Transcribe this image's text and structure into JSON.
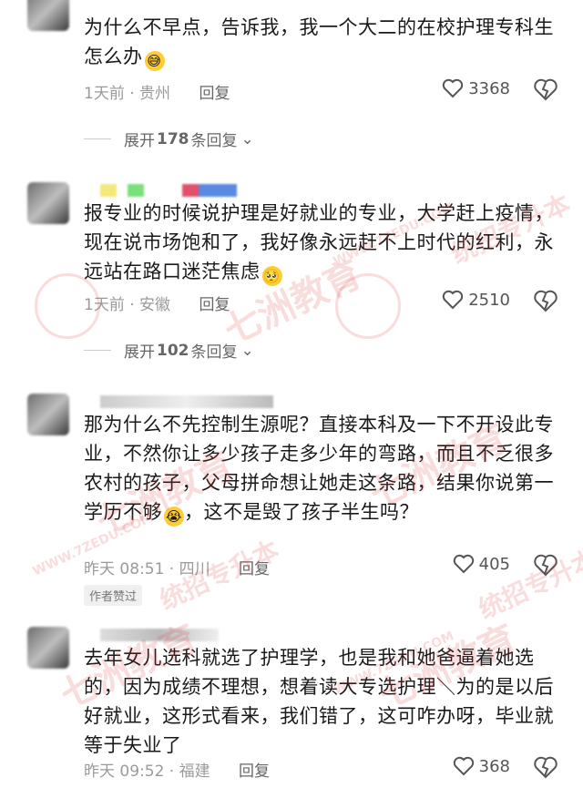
{
  "comments": [
    {
      "text": "为什么不早点，告诉我，我一个大二的在校护理专科生怎么办",
      "emoji": "😅",
      "time": "1天前",
      "location": "贵州",
      "reply": "回复",
      "likes": "3368",
      "expand": {
        "prefix": "展开",
        "count": "178",
        "suffix": "条回复"
      }
    },
    {
      "text": "报专业的时候说护理是好就业的专业，大学赶上疫情，现在说市场饱和了，我好像永远赶不上时代的红利，永远站在路口迷茫焦虑",
      "emoji": "🥺",
      "time": "1天前",
      "location": "安徽",
      "reply": "回复",
      "likes": "2510",
      "expand": {
        "prefix": "展开",
        "count": "102",
        "suffix": "条回复"
      }
    },
    {
      "text": "那为什么不先控制生源呢？直接本科及一下不开设此专业，不然你让多少孩子走多少年的弯路，而且不乏很多农村的孩子，父母拼命想让她走这条路，结果你说第一学历不够",
      "emoji": "😭",
      "text_after": "，这不是毁了孩子半生吗？",
      "time": "昨天 08:51",
      "location": "四川",
      "reply": "回复",
      "likes": "405",
      "author_liked": "作者赞过"
    },
    {
      "text": "去年女儿选科就选了护理学，也是我和她爸逼着她选的，因为成绩不理想，想着读大专选护理＼为的是以后好就业，这形式看来，我们错了，这可咋办呀，毕业就等于失业了",
      "time": "昨天 09:52",
      "location": "福建",
      "reply": "回复",
      "likes": "368"
    }
  ],
  "watermark": {
    "text": "七洲教育",
    "sub": "统招专升本",
    "site": "WWW.7ZEDU.COM"
  },
  "colors": {
    "meta": "#9a9a9a",
    "watermark": "#dc3c3c"
  }
}
